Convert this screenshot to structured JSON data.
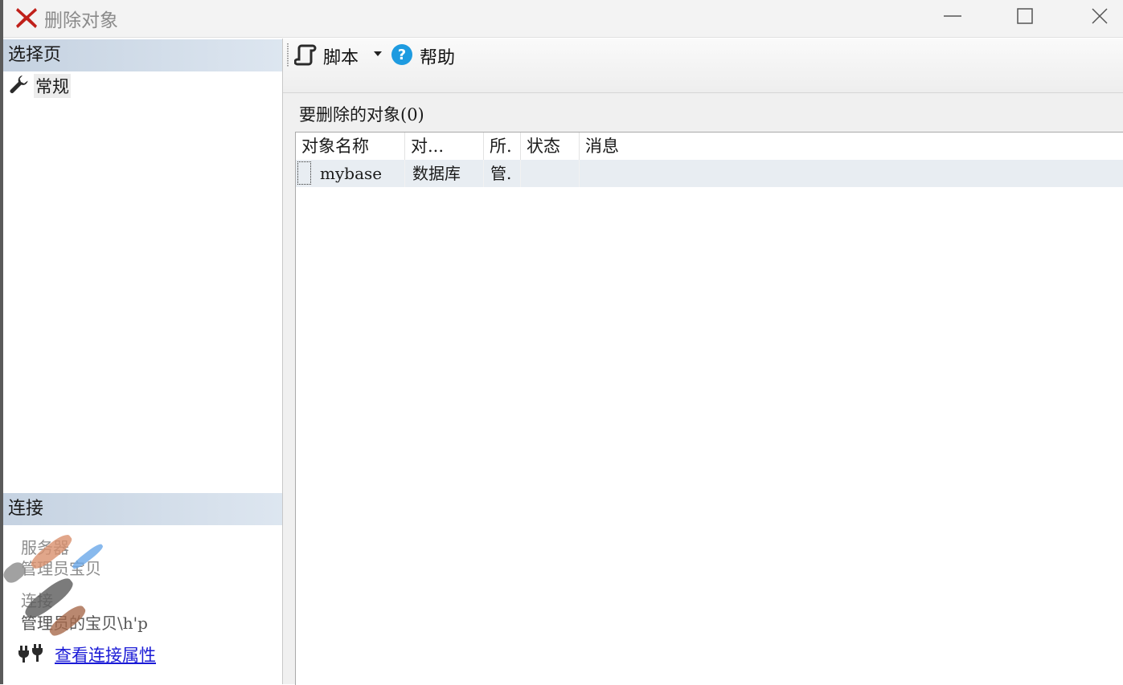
{
  "window": {
    "title": "删除对象",
    "controls": {
      "minimize": "minimize-icon",
      "maximize": "maximize-icon",
      "close": "close-icon"
    },
    "title_icon": "red-x-delete-icon"
  },
  "left_panel": {
    "select_page_header": "选择页",
    "pages": [
      {
        "label": "常规",
        "icon": "wrench-icon"
      }
    ],
    "connection_header": "连接",
    "connection_lines": [
      "服务器",
      "管理员宝贝",
      "连接",
      "管理员的宝贝\\h'p"
    ],
    "view_connection_link": "查看连接属性",
    "view_connection_icon": "plug-icon"
  },
  "toolbar": {
    "script_label": "脚本",
    "script_icon": "script-icon",
    "help_label": "帮助",
    "help_icon": "help-icon"
  },
  "main": {
    "objects_title": "要删除的对象(0)",
    "columns": [
      "对象名称",
      "对...",
      "所.",
      "状态",
      "消息"
    ],
    "rows": [
      {
        "name": "mybase",
        "type": "数据库",
        "owner": "管.",
        "status": "",
        "message": ""
      }
    ]
  },
  "colors": {
    "section_header_start": "#c5d2e1",
    "section_header_end": "#dde6f0",
    "selected_row": "#e8edf2",
    "link": "#1a1ad6",
    "help_icon": "#1e9be0",
    "close_x": "#c0201a"
  }
}
